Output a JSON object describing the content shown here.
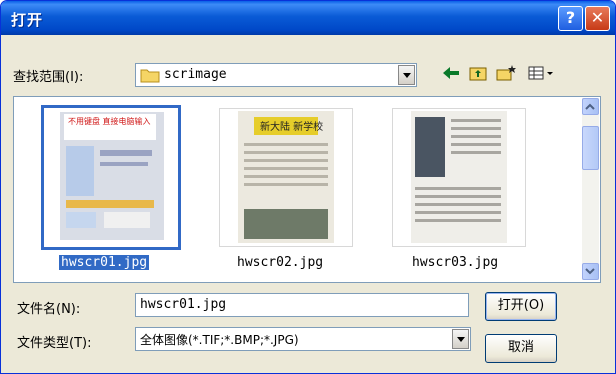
{
  "window": {
    "title": "打开"
  },
  "titlebar_buttons": {
    "help": "?",
    "close": "✕"
  },
  "look_in": {
    "label": "查找范围(I):",
    "value": "scrimage"
  },
  "toolbar_icons": [
    "back-arrow-icon",
    "up-folder-icon",
    "new-folder-icon",
    "view-menu-icon"
  ],
  "files": [
    {
      "name": "hwscr01.jpg",
      "selected": true
    },
    {
      "name": "hwscr02.jpg",
      "selected": false
    },
    {
      "name": "hwscr03.jpg",
      "selected": false
    }
  ],
  "thumb_texts": {
    "poster_heading": "不用键盘 直接电脑输入",
    "magazine_heading": "新大陆 新学校"
  },
  "filename_field": {
    "label": "文件名(N):",
    "value": "hwscr01.jpg"
  },
  "filetype_field": {
    "label": "文件类型(T):",
    "value": "全体图像(*.TIF;*.BMP;*.JPG)"
  },
  "buttons": {
    "open": "打开(O)",
    "cancel": "取消"
  }
}
